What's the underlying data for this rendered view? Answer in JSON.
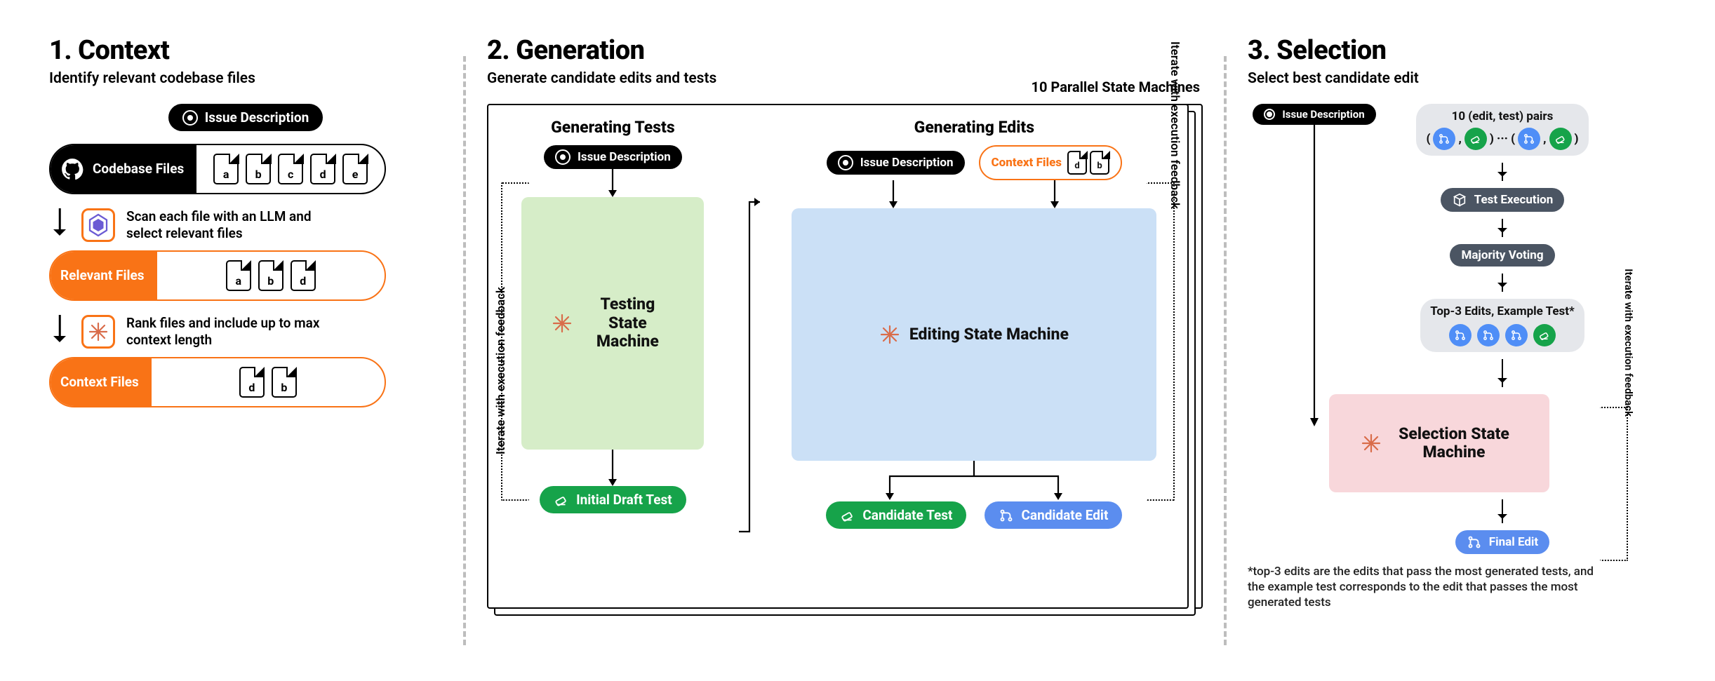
{
  "context": {
    "title": "1. Context",
    "sub": "Identify relevant codebase files",
    "issue": "Issue Description",
    "codebase": "Codebase Files",
    "files_all": [
      "a",
      "b",
      "c",
      "d",
      "e"
    ],
    "scan": "Scan each file with an LLM and select relevant files",
    "relevant": "Relevant Files",
    "files_rel": [
      "a",
      "b",
      "d"
    ],
    "rank": "Rank files and include up to max context length",
    "ctx": "Context Files",
    "files_ctx": [
      "d",
      "b"
    ]
  },
  "generation": {
    "title": "2. Generation",
    "sub": "Generate candidate edits and tests",
    "parallel": "10 Parallel State Machines",
    "tests_h": "Generating Tests",
    "edits_h": "Generating Edits",
    "issue": "Issue Description",
    "ctx": "Context Files",
    "ctx_files": [
      "d",
      "b"
    ],
    "testing_sm": "Testing State Machine",
    "editing_sm": "Editing State Machine",
    "iter": "Iterate with execution feedback",
    "draft": "Initial Draft Test",
    "cand_test": "Candidate Test",
    "cand_edit": "Candidate Edit"
  },
  "selection": {
    "title": "3. Selection",
    "sub": "Select best candidate edit",
    "issue": "Issue Description",
    "pairs": "10 (edit, test) pairs",
    "exec": "Test Execution",
    "majority": "Majority Voting",
    "top3": "Top-3 Edits, Example Test*",
    "sm": "Selection State Machine",
    "final": "Final Edit",
    "iter": "Iterate with execution feedback",
    "foot": "*top-3 edits are the edits that pass the most generated tests, and the example test corresponds to the edit that passes the most generated tests"
  }
}
